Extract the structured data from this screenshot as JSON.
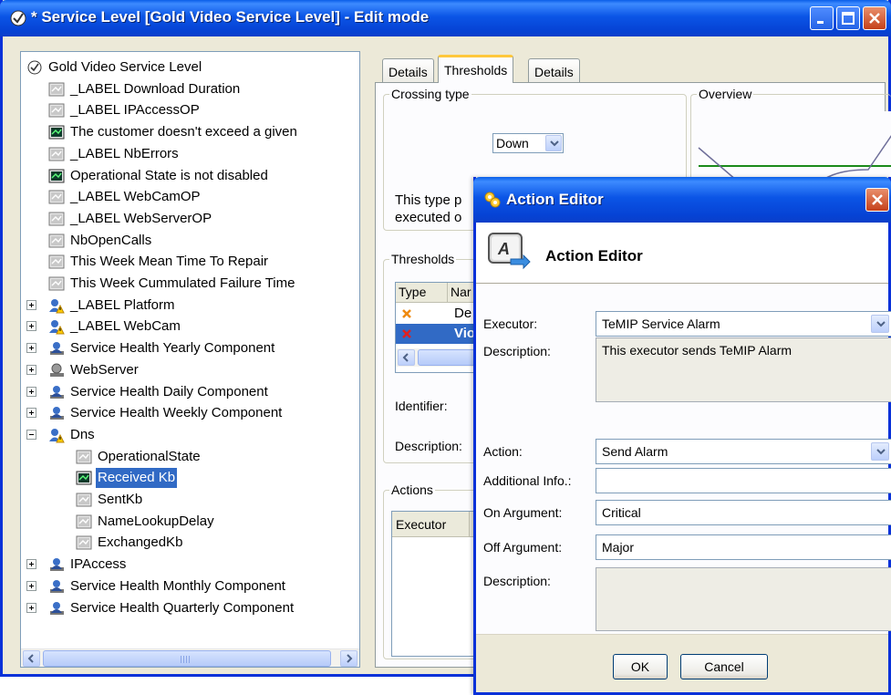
{
  "window": {
    "title": "* Service Level [Gold Video Service Level] - Edit mode",
    "title_icon": "service-level-icon",
    "controls": [
      "minimize",
      "maximize",
      "close"
    ]
  },
  "tree": {
    "items": [
      {
        "label": "Gold Video Service Level",
        "icon": "service-level-icon"
      },
      {
        "label": "_LABEL Download Duration",
        "icon": "gray-chart-icon"
      },
      {
        "label": "_LABEL IPAccessOP",
        "icon": "gray-chart-icon"
      },
      {
        "label": "The customer doesn't exceed a given",
        "icon": "green-chart-icon"
      },
      {
        "label": "_LABEL NbErrors",
        "icon": "gray-chart-icon"
      },
      {
        "label": "Operational State is not disabled",
        "icon": "green-chart-icon"
      },
      {
        "label": "_LABEL WebCamOP",
        "icon": "gray-chart-icon"
      },
      {
        "label": "_LABEL WebServerOP",
        "icon": "gray-chart-icon"
      },
      {
        "label": "NbOpenCalls",
        "icon": "gray-chart-icon"
      },
      {
        "label": "This Week Mean Time To Repair",
        "icon": "gray-chart-icon"
      },
      {
        "label": "This Week Cummulated Failure Time",
        "icon": "gray-chart-icon"
      },
      {
        "label": "_LABEL Platform",
        "icon": "component-warning-icon"
      },
      {
        "label": "_LABEL WebCam",
        "icon": "component-warning-icon"
      },
      {
        "label": "Service Health Yearly Component",
        "icon": "component-user-icon"
      },
      {
        "label": "WebServer",
        "icon": "component-gray-icon"
      },
      {
        "label": "Service Health Daily Component",
        "icon": "component-user-icon"
      },
      {
        "label": "Service Health Weekly Component",
        "icon": "component-user-icon"
      },
      {
        "label": "Dns",
        "icon": "component-warning-icon"
      },
      {
        "label": "OperationalState",
        "icon": "gray-chart-icon"
      },
      {
        "label": "Received Kb",
        "icon": "green-chart-icon"
      },
      {
        "label": "SentKb",
        "icon": "gray-chart-icon"
      },
      {
        "label": "NameLookupDelay",
        "icon": "gray-chart-icon"
      },
      {
        "label": "ExchangedKb",
        "icon": "gray-chart-icon"
      },
      {
        "label": "IPAccess",
        "icon": "component-user-icon"
      },
      {
        "label": "Service Health Monthly Component",
        "icon": "component-user-icon"
      },
      {
        "label": "Service Health Quarterly Component",
        "icon": "component-user-icon"
      }
    ],
    "selected": "Received Kb"
  },
  "tabs": [
    {
      "label": "Details"
    },
    {
      "label": "Thresholds",
      "active": true
    },
    {
      "label": "Details"
    }
  ],
  "thresholds_tab": {
    "crossing_type": {
      "legend": "Crossing type",
      "value": "Down",
      "desc_line1": "This type p",
      "desc_line2": "executed o"
    },
    "overview": {
      "legend": "Overview"
    },
    "thresholds": {
      "legend": "Thresholds",
      "columns": [
        "Type",
        "Nar"
      ],
      "rows": [
        {
          "name": "De",
          "icon": "orange-x-icon"
        },
        {
          "name": "Vio",
          "icon": "red-x-icon",
          "selected": true
        }
      ],
      "identifier_label": "Identifier:",
      "description_label": "Description:"
    },
    "actions": {
      "legend": "Actions",
      "columns": [
        "Executor"
      ]
    }
  },
  "action_editor": {
    "title": "Action Editor",
    "header": "Action Editor",
    "fields": {
      "executor": {
        "label": "Executor:",
        "value": "TeMIP Service Alarm"
      },
      "executor_description": {
        "label": "Description:",
        "value": "This executor sends TeMIP Alarm"
      },
      "action": {
        "label": "Action:",
        "value": "Send Alarm"
      },
      "additional_info": {
        "label": "Additional Info.:",
        "value": ""
      },
      "on_argument": {
        "label": "On Argument:",
        "value": "Critical"
      },
      "off_argument": {
        "label": "Off Argument:",
        "value": "Major"
      },
      "action_description": {
        "label": "Description:",
        "value": ""
      }
    },
    "buttons": {
      "ok": "OK",
      "cancel": "Cancel"
    }
  },
  "colors": {
    "titlebar": "#0b55e6",
    "selection": "#316ac5",
    "panel": "#ece9d8",
    "tab_highlight": "#ffc83c",
    "overview_green": "#1a8a1a",
    "overview_yellow": "#ffff66"
  }
}
